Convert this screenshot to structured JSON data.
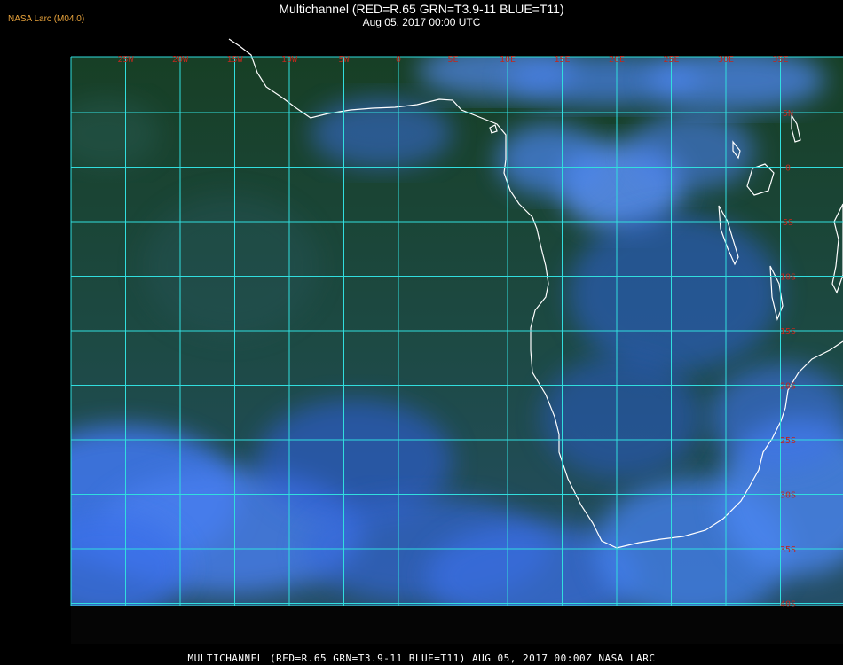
{
  "header": {
    "badge": "NASA Larc (M04.0)",
    "title": "Multichannel (RED=R.65 GRN=T3.9-11 BLUE=T11)",
    "subtitle": "Aug 05, 2017 00:00 UTC"
  },
  "footer": {
    "caption": "MULTICHANNEL (RED=R.65 GRN=T3.9-11 BLUE=T11) AUG 05, 2017 00:00Z  NASA LARC"
  },
  "grid": {
    "longitude_labels": [
      "25W",
      "20W",
      "15W",
      "10W",
      "5W",
      "0",
      "5E",
      "10E",
      "15E",
      "20E",
      "25E",
      "30E",
      "35E"
    ],
    "latitude_labels": [
      "5N",
      "0",
      "5S",
      "10S",
      "15S",
      "20S",
      "25S",
      "30S",
      "35S",
      "40S"
    ]
  },
  "colors": {
    "background": "#000000",
    "ocean": "#1f4a46",
    "land_dark": "#14431d",
    "cloud": "#3f78f0",
    "gridline": "#31dede",
    "grid_label": "#c0281e",
    "coast": "#ffffff",
    "badge": "#e8a33c"
  }
}
